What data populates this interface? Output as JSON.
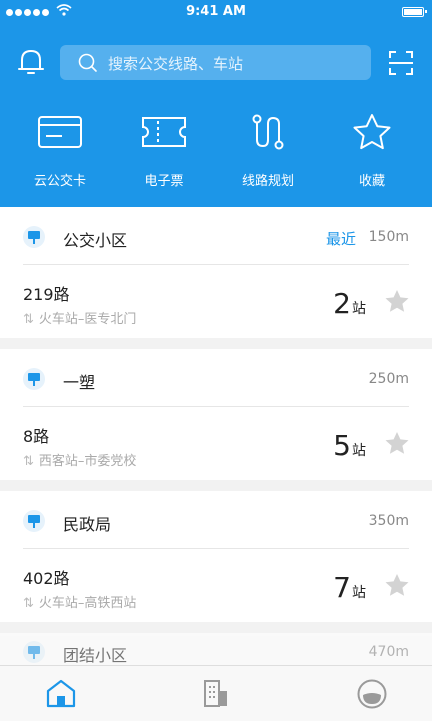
{
  "status_bar": {
    "time": "9:41 AM"
  },
  "search": {
    "placeholder": "搜索公交线路、车站"
  },
  "quick_actions": [
    {
      "label": "云公交卡",
      "icon": "card-icon"
    },
    {
      "label": "电子票",
      "icon": "ticket-icon"
    },
    {
      "label": "线路规划",
      "icon": "route-icon"
    },
    {
      "label": "收藏",
      "icon": "star-icon"
    }
  ],
  "stops": [
    {
      "name": "公交小区",
      "tag": "最近",
      "distance": "150m",
      "route": "219路",
      "direction": "火车站–医专北门",
      "stops_away": "2",
      "unit": "站"
    },
    {
      "name": "一塑",
      "tag": "",
      "distance": "250m",
      "route": "8路",
      "direction": "西客站–市委党校",
      "stops_away": "5",
      "unit": "站"
    },
    {
      "name": "民政局",
      "tag": "",
      "distance": "350m",
      "route": "402路",
      "direction": "火车站–高铁西站",
      "stops_away": "7",
      "unit": "站"
    },
    {
      "name": "团结小区",
      "tag": "",
      "distance": "470m"
    }
  ],
  "tab_bar": {
    "icons": [
      "home-icon",
      "building-icon",
      "face-icon"
    ],
    "active": "home-icon"
  },
  "colors": {
    "accent": "#1c96e8",
    "inactive_icon": "#9a9a9a"
  }
}
